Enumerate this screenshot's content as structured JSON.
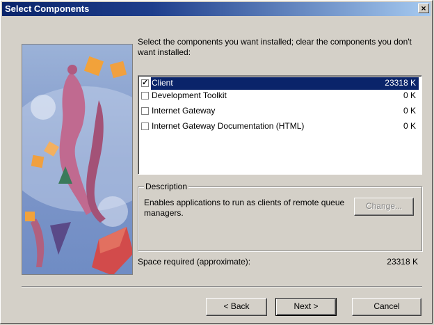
{
  "window": {
    "title": "Select Components",
    "close_symbol": "×"
  },
  "intro_text": "Select the components you want installed; clear the components you don't want installed:",
  "components": [
    {
      "name": "Client",
      "size": "23318 K",
      "checked": true,
      "selected": true
    },
    {
      "name": "Development Toolkit",
      "size": "0 K",
      "checked": false,
      "selected": false
    },
    {
      "name": "Internet Gateway",
      "size": "0 K",
      "checked": false,
      "selected": false
    },
    {
      "name": "Internet Gateway Documentation (HTML)",
      "size": "0 K",
      "checked": false,
      "selected": false
    }
  ],
  "description": {
    "legend": "Description",
    "text": "Enables applications to run as clients of remote queue managers.",
    "change_label": "Change..."
  },
  "space": {
    "label": "Space required (approximate):",
    "value": "23318 K"
  },
  "buttons": {
    "back": "< Back",
    "next": "Next >",
    "cancel": "Cancel"
  },
  "colors": {
    "title_active": "#0a246a",
    "selection": "#0a246a",
    "face": "#d4d0c8"
  }
}
